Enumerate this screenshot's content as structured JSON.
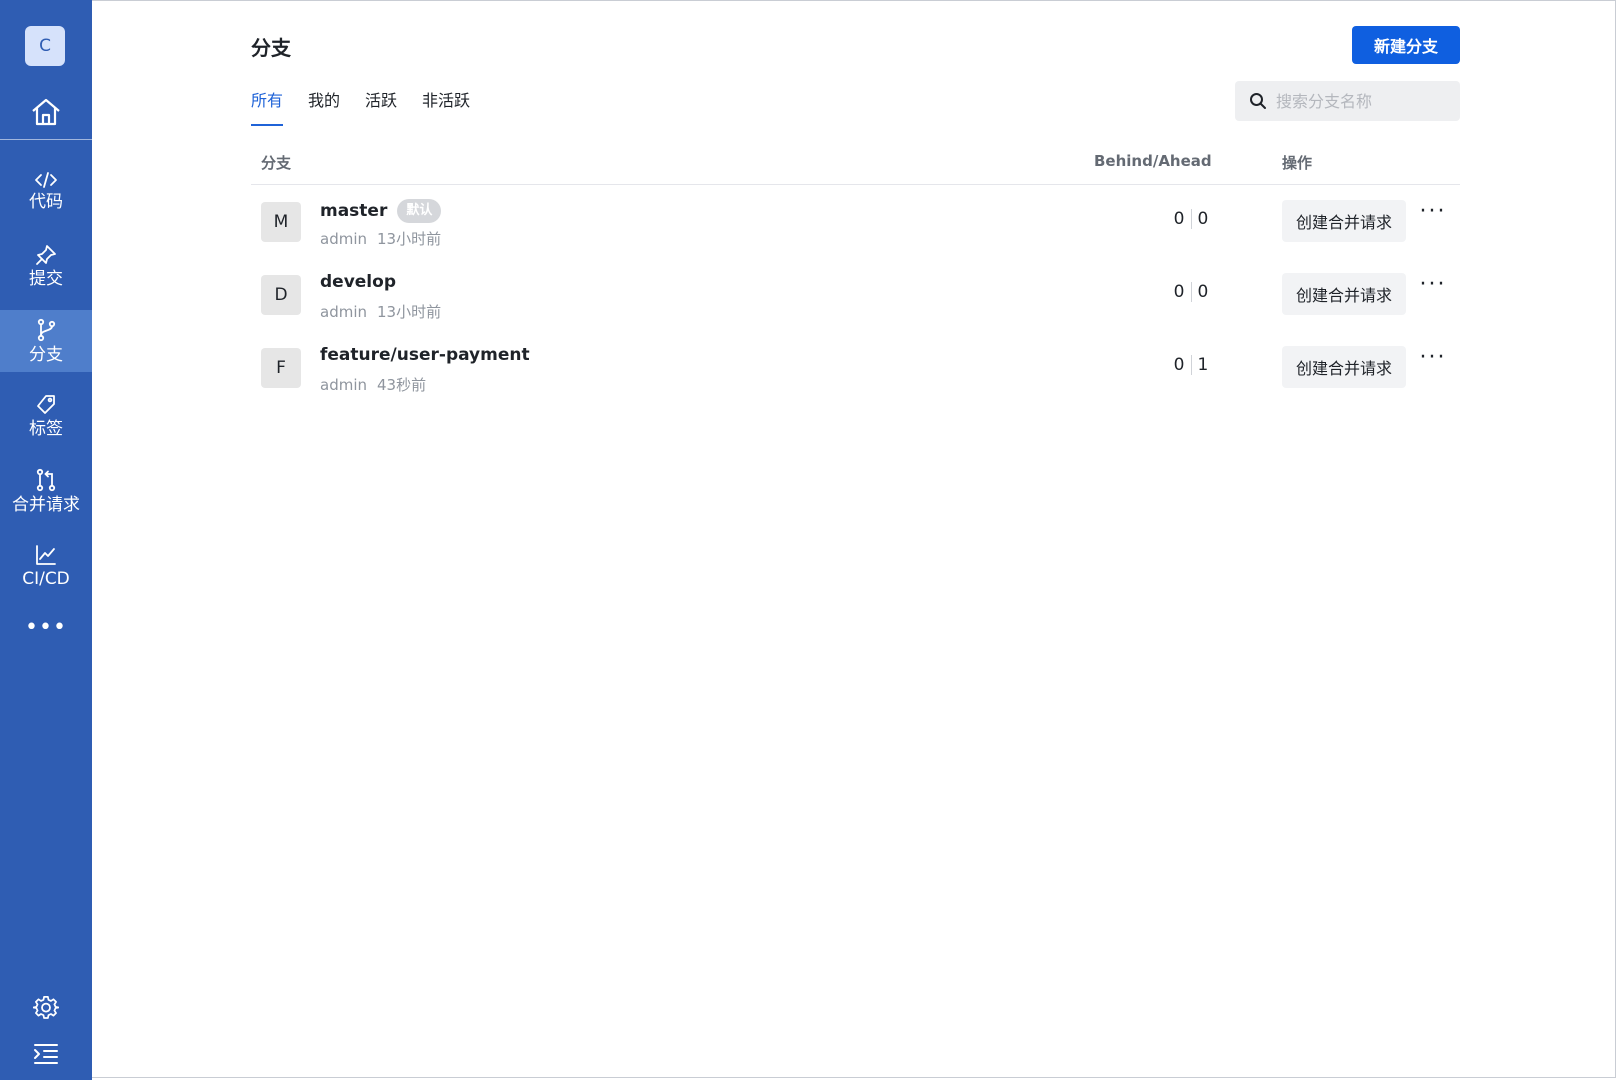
{
  "sidebar": {
    "repo_initial": "C",
    "nav": [
      {
        "label": "代码",
        "icon": "code-icon",
        "active": false
      },
      {
        "label": "提交",
        "icon": "pin-icon",
        "active": false
      },
      {
        "label": "分支",
        "icon": "branch-icon",
        "active": true
      },
      {
        "label": "标签",
        "icon": "tag-icon",
        "active": false
      },
      {
        "label": "合并请求",
        "icon": "merge-request-icon",
        "active": false
      },
      {
        "label": "CI/CD",
        "icon": "chart-icon",
        "active": false
      }
    ],
    "more_label": "•••"
  },
  "header": {
    "title": "分支",
    "new_branch_label": "新建分支"
  },
  "tabs": [
    {
      "label": "所有",
      "active": true
    },
    {
      "label": "我的",
      "active": false
    },
    {
      "label": "活跃",
      "active": false
    },
    {
      "label": "非活跃",
      "active": false
    }
  ],
  "search": {
    "placeholder": "搜索分支名称"
  },
  "table": {
    "columns": {
      "branch": "分支",
      "behind_ahead": "Behind/Ahead",
      "actions": "操作"
    },
    "rows": [
      {
        "initial": "M",
        "name": "master",
        "badge": "默认",
        "author": "admin",
        "time": "13小时前",
        "behind": "0",
        "ahead": "0",
        "action_label": "创建合并请求"
      },
      {
        "initial": "D",
        "name": "develop",
        "badge": "",
        "author": "admin",
        "time": "13小时前",
        "behind": "0",
        "ahead": "0",
        "action_label": "创建合并请求"
      },
      {
        "initial": "F",
        "name": "feature/user-payment",
        "badge": "",
        "author": "admin",
        "time": "43秒前",
        "behind": "0",
        "ahead": "1",
        "action_label": "创建合并请求"
      }
    ],
    "more_label": "···"
  },
  "colors": {
    "sidebar": "#2f5db3",
    "sidebar_active": "#4f7ecb",
    "primary": "#0f5fe0",
    "tab_active": "#1f63d8"
  }
}
